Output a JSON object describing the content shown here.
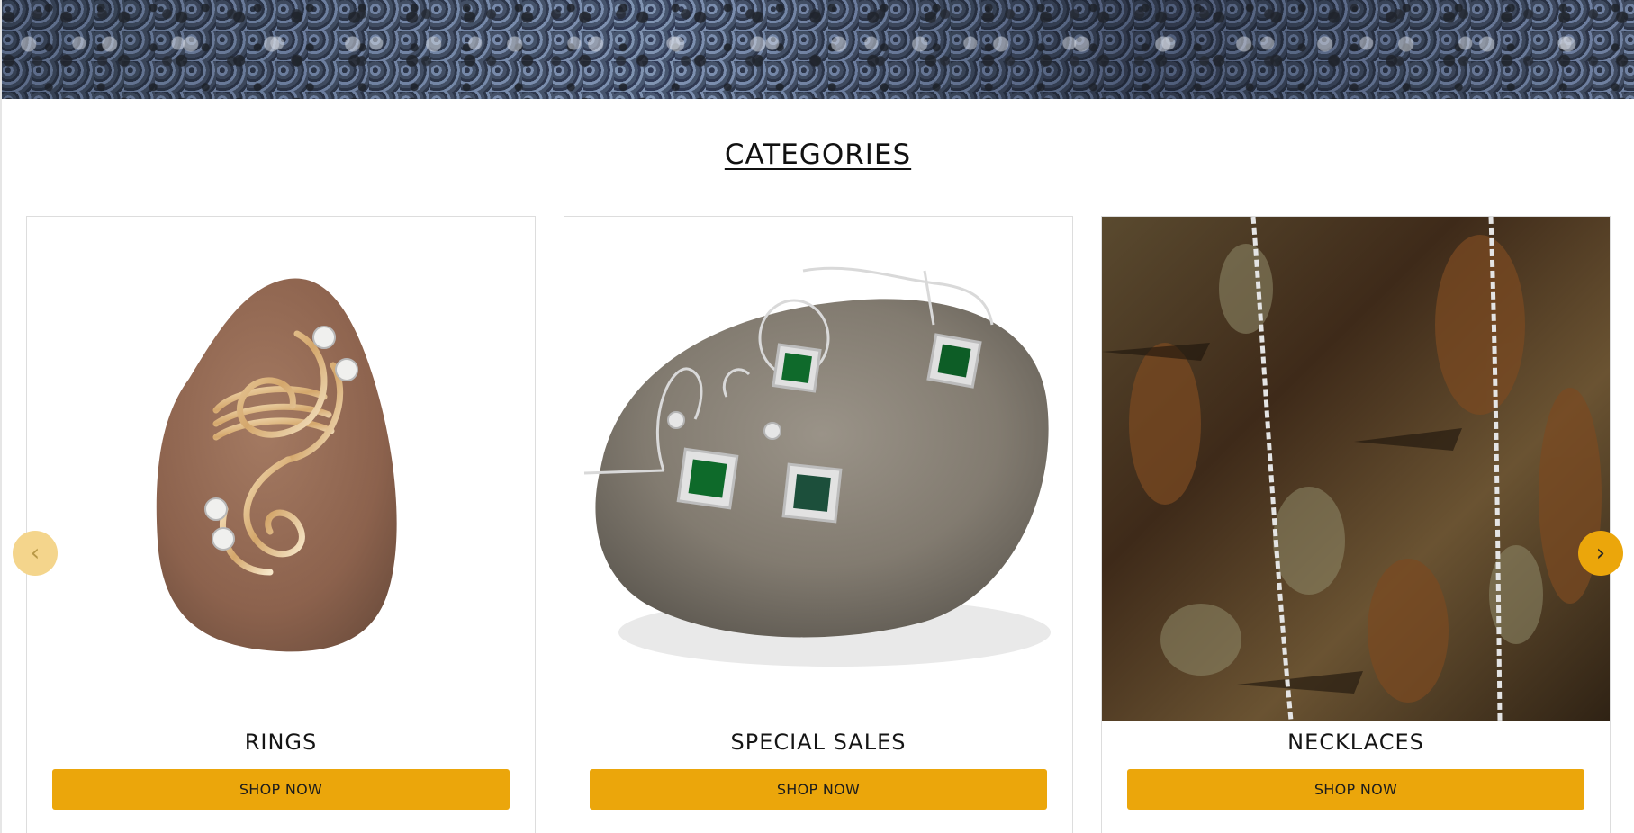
{
  "section": {
    "heading": "CATEGORIES"
  },
  "categories": [
    {
      "title": "RINGS",
      "button": "SHOP NOW"
    },
    {
      "title": "SPECIAL SALES",
      "button": "SHOP NOW"
    },
    {
      "title": "NECKLACES",
      "button": "SHOP NOW"
    }
  ],
  "carousel": {
    "prev_icon": "chevron-left-icon",
    "next_icon": "chevron-right-icon"
  },
  "colors": {
    "accent": "#eba60b",
    "accent_faded": "#f4d58c",
    "text": "#111111"
  }
}
